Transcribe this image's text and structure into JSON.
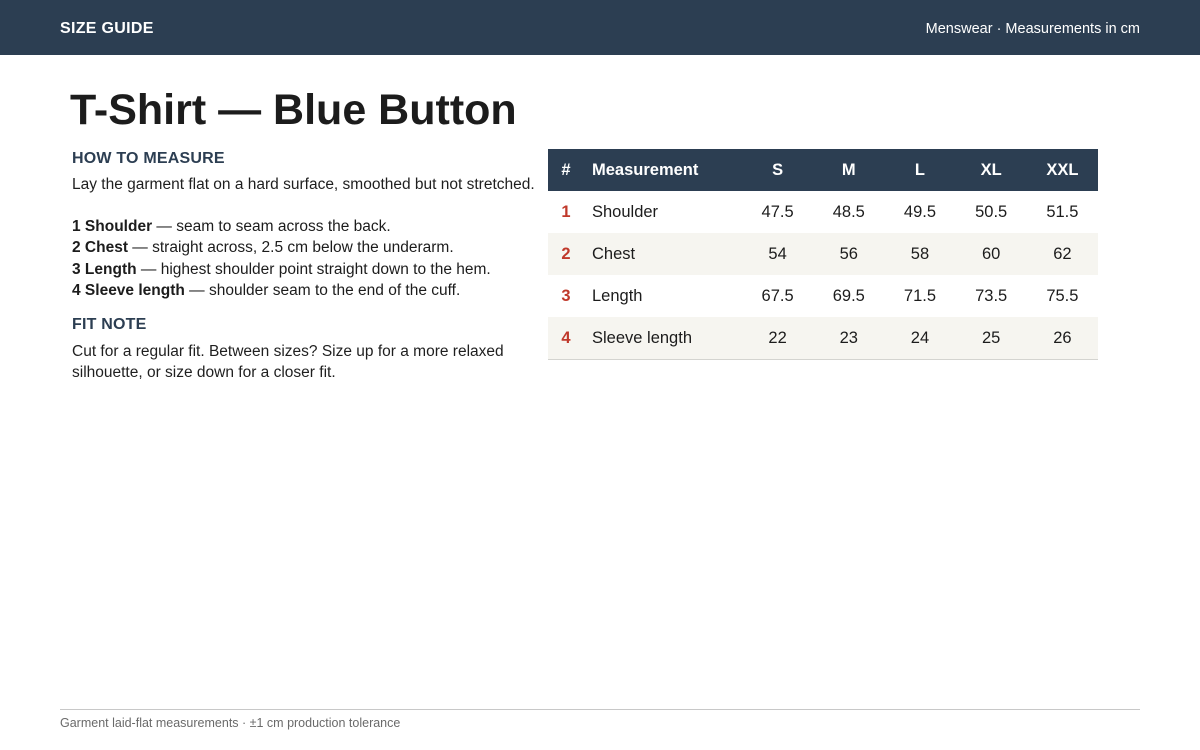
{
  "header": {
    "title": "SIZE GUIDE",
    "meta": "Menswear · Measurements in cm"
  },
  "page": {
    "title": "T-Shirt — Blue Button"
  },
  "how_to_measure": {
    "heading": "HOW TO MEASURE",
    "intro": "Lay the garment flat on a hard surface, smoothed but not stretched.",
    "steps": [
      {
        "label": "1 Shoulder",
        "text": " — seam to seam across the back."
      },
      {
        "label": "2 Chest",
        "text": " — straight across, 2.5 cm below the underarm."
      },
      {
        "label": "3 Length",
        "text": " — highest shoulder point straight down to the hem."
      },
      {
        "label": "4 Sleeve length",
        "text": " — shoulder seam to the end of the cuff."
      }
    ]
  },
  "fit_note": {
    "heading": "FIT NOTE",
    "text": "Cut for a regular fit. Between sizes? Size up for a more relaxed silhouette, or size down for a closer fit."
  },
  "table": {
    "headers": [
      "#",
      "Measurement",
      "S",
      "M",
      "L",
      "XL",
      "XXL"
    ],
    "rows": [
      {
        "num": "1",
        "name": "Shoulder",
        "values": [
          "47.5",
          "48.5",
          "49.5",
          "50.5",
          "51.5"
        ]
      },
      {
        "num": "2",
        "name": "Chest",
        "values": [
          "54",
          "56",
          "58",
          "60",
          "62"
        ]
      },
      {
        "num": "3",
        "name": "Length",
        "values": [
          "67.5",
          "69.5",
          "71.5",
          "73.5",
          "75.5"
        ]
      },
      {
        "num": "4",
        "name": "Sleeve length",
        "values": [
          "22",
          "23",
          "24",
          "25",
          "26"
        ]
      }
    ]
  },
  "footer": {
    "note": "Garment laid-flat measurements · ±1 cm production tolerance"
  },
  "colors": {
    "header_bg": "#2c3e52",
    "accent_number": "#c0392b",
    "row_stripe": "#f6f5f0"
  }
}
